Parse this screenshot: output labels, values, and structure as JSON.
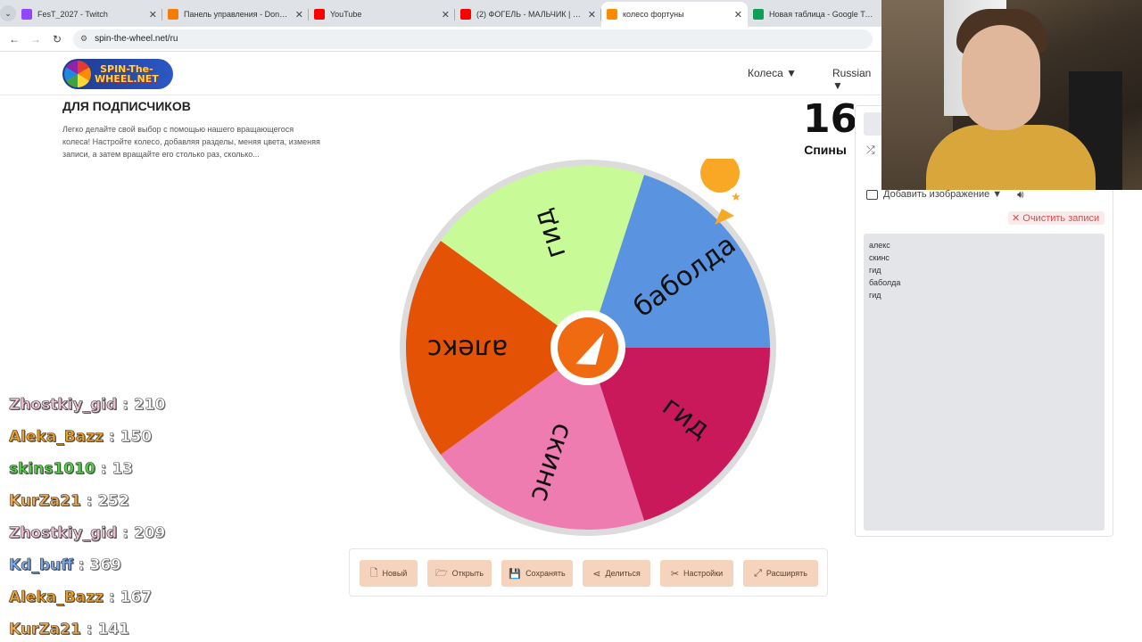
{
  "browser": {
    "tabs": [
      {
        "title": "FesT_2027 - Twitch",
        "fav": "#9146ff",
        "active": false
      },
      {
        "title": "Панель управления - Donation",
        "fav": "#f57d07",
        "active": false
      },
      {
        "title": "YouTube",
        "fav": "#ff0000",
        "active": false
      },
      {
        "title": "(2) ФОГЕЛЬ - МАЛЬЧИК | Offic",
        "fav": "#ff0000",
        "active": false
      },
      {
        "title": "колесо фортуны",
        "fav": "#fb8c00",
        "active": true
      },
      {
        "title": "Новая таблица - Google Табл",
        "fav": "#0f9d58",
        "active": false
      }
    ],
    "url": "spin-the-wheel.net/ru"
  },
  "site": {
    "logo_line1": "SPIN-The-",
    "logo_line2": "WHEEL.NET",
    "menu_wheels": "Колеса ▼",
    "menu_lang": "Russian ▼"
  },
  "intro": {
    "title": "ДЛЯ ПОДПИСЧИКОВ",
    "desc": "Легко делайте свой выбор с помощью нашего вращающегося колеса! Настройте колесо, добавляя разделы, меняя цвета, изменяя записи, а затем вращайте его столько раз, сколько..."
  },
  "spins": {
    "count": "16",
    "label": "Спины"
  },
  "wheel": {
    "segments": [
      {
        "label": "гид",
        "color": "#c8fa98"
      },
      {
        "label": "баболда",
        "color": "#5a93e0"
      },
      {
        "label": "гид",
        "color": "#c9195a"
      },
      {
        "label": "скинс",
        "color": "#ee7cb0"
      },
      {
        "label": "алекс",
        "color": "#e45305"
      }
    ],
    "hub_color": "#ef6a10",
    "pointer_color": "#f9a825"
  },
  "toolbar": [
    {
      "icon": "🗋",
      "label": "Новый",
      "name": "new-button"
    },
    {
      "icon": "🗁",
      "label": "Открыть",
      "name": "open-button"
    },
    {
      "icon": "💾",
      "label": "Сохранять",
      "name": "save-button"
    },
    {
      "icon": "⋖",
      "label": "Делиться",
      "name": "share-button"
    },
    {
      "icon": "✂",
      "label": "Настройки",
      "name": "settings-button"
    },
    {
      "icon": "⤢",
      "label": "Расширять",
      "name": "expand-button"
    }
  ],
  "panel": {
    "add_image": "Добавить изображение ▼",
    "clear": "✕ Очистить записи",
    "entries": [
      "алекс",
      "скинс",
      "гид",
      "баболда",
      "гид"
    ]
  },
  "chat": [
    {
      "name": "Zhostkiy_gid",
      "score": ": 210",
      "color": "#f0c4d6"
    },
    {
      "name": "Aleka_Bazz",
      "score": ": 150",
      "color": "#f0a020"
    },
    {
      "name": "skins1010",
      "score": ": 13",
      "color": "#4ad63a"
    },
    {
      "name": "KurZa21",
      "score": ": 252",
      "color": "#f0a84a"
    },
    {
      "name": "Zhostkiy_gid",
      "score": ": 209",
      "color": "#f0c4d6"
    },
    {
      "name": "Kd_buff",
      "score": ": 369",
      "color": "#7aa8e8"
    },
    {
      "name": "Aleka_Bazz",
      "score": ": 167",
      "color": "#f0a020"
    },
    {
      "name": "KurZa21",
      "score": ": 141",
      "color": "#f0a84a"
    }
  ]
}
